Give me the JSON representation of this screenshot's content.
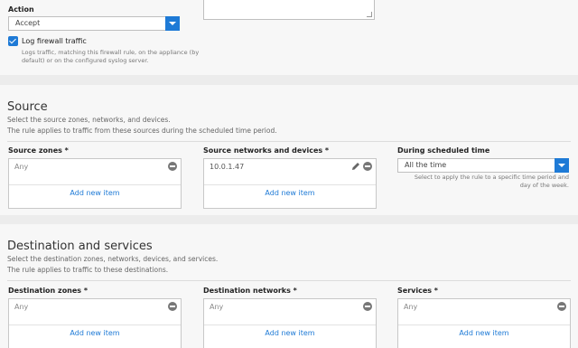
{
  "action": {
    "label": "Action",
    "value": "Accept",
    "log_label": "Log firewall traffic",
    "log_checked": true,
    "log_help_line1": "Logs traffic, matching this firewall rule, on the appliance (by",
    "log_help_line2": "default) or on the configured syslog server."
  },
  "source": {
    "title": "Source",
    "desc1": "Select the source zones, networks, and devices.",
    "desc2": "The rule applies to traffic from these sources during the scheduled time period.",
    "zones": {
      "label": "Source zones *",
      "item": "Any",
      "add": "Add new item"
    },
    "networks": {
      "label": "Source networks and devices *",
      "item": "10.0.1.47",
      "add": "Add new item"
    },
    "schedule": {
      "label": "During scheduled time",
      "value": "All the time",
      "help1": "Select to apply the rule to a specific time period and",
      "help2": "day of the week."
    }
  },
  "destination": {
    "title": "Destination and services",
    "desc1": "Select the destination zones, networks, devices, and services.",
    "desc2": "The rule applies to traffic to these destinations.",
    "zones": {
      "label": "Destination zones *",
      "item": "Any",
      "add": "Add new item"
    },
    "networks": {
      "label": "Destination networks *",
      "item": "Any",
      "add": "Add new item"
    },
    "services": {
      "label": "Services *",
      "item": "Any",
      "add": "Add new item"
    }
  },
  "colors": {
    "accent": "#1e7ad6",
    "panel": "#f7f7f7",
    "background": "#ececec"
  },
  "icons": [
    "chevron-down-icon",
    "checkbox-checked-icon",
    "remove-icon",
    "edit-icon"
  ]
}
